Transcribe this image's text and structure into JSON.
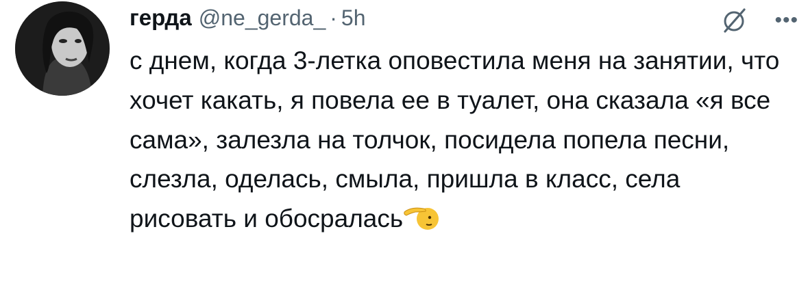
{
  "tweet": {
    "author": {
      "display_name": "герда",
      "handle": "@ne_gerda_",
      "avatar": "avatar-photo"
    },
    "separator": "·",
    "time": "5h",
    "icons": {
      "grok": "grok-icon",
      "more": "more-options-icon",
      "emoji": "saluting-face-emoji"
    },
    "text": "с днем, когда 3-летка оповестила меня на занятии, что хочет какать, я повела ее в туалет, она сказала «я все сама», залезла на толчок, посидела попела песни, слезла, оделась, смыла, пришла в класс, села рисовать и обосралась",
    "colors": {
      "text": "#0f1419",
      "secondary": "#536471"
    }
  }
}
